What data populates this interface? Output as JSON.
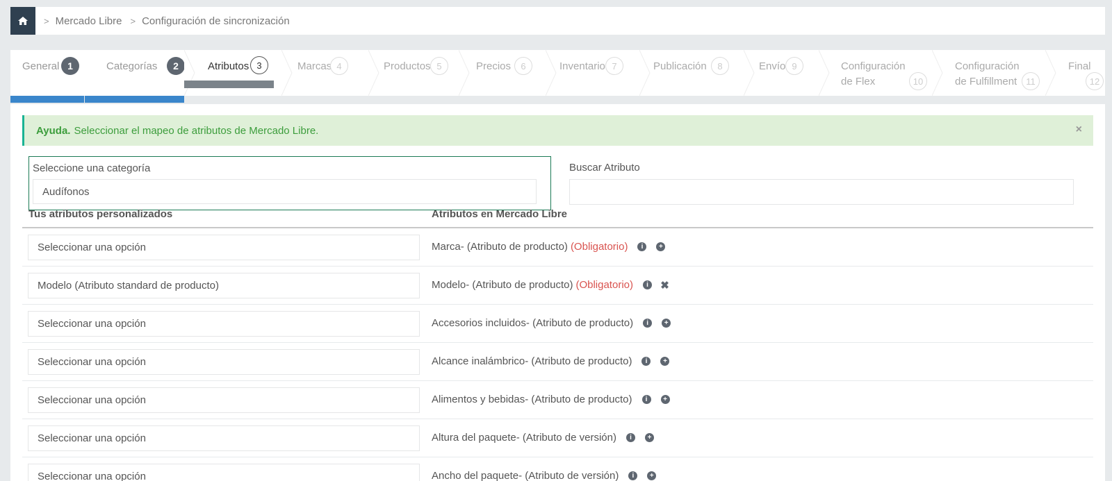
{
  "breadcrumb": {
    "items": [
      "Mercado Libre",
      "Configuración de sincronización"
    ],
    "separator": ">"
  },
  "wizard": {
    "steps": [
      {
        "label": "General",
        "num": "1",
        "state": "done"
      },
      {
        "label": "Categorías",
        "num": "2",
        "state": "done"
      },
      {
        "label": "Atributos",
        "num": "3",
        "state": "active"
      },
      {
        "label": "Marcas",
        "num": "4",
        "state": "todo"
      },
      {
        "label": "Productos",
        "num": "5",
        "state": "todo"
      },
      {
        "label": "Precios",
        "num": "6",
        "state": "todo"
      },
      {
        "label": "Inventario",
        "num": "7",
        "state": "todo"
      },
      {
        "label": "Publicación",
        "num": "8",
        "state": "todo"
      },
      {
        "label": "Envío",
        "num": "9",
        "state": "todo"
      },
      {
        "label": "Configuración de Flex",
        "label1": "Configuración",
        "label2": "de Flex",
        "num": "10",
        "state": "todo"
      },
      {
        "label": "Configuración de Fulfillment",
        "label1": "Configuración",
        "label2": "de Fulfillment",
        "num": "11",
        "state": "todo"
      },
      {
        "label": "Final",
        "num": "12",
        "state": "todo"
      }
    ]
  },
  "alert": {
    "bold": "Ayuda.",
    "text": "Seleccionar el mapeo de atributos de Mercado Libre.",
    "close": "×"
  },
  "category": {
    "label": "Seleccione una categoría",
    "value": "Audífonos"
  },
  "search": {
    "label": "Buscar Atributo",
    "value": "",
    "placeholder": ""
  },
  "columns": {
    "left": "Tus atributos personalizados",
    "right": "Atributos en Mercado Libre"
  },
  "rows": [
    {
      "select": "Seleccionar una opción",
      "name": "Marca",
      "type": " - (Atributo de producto)",
      "required": "(Obligatorio)",
      "action": "add"
    },
    {
      "select": "Modelo (Atributo standard de producto)",
      "name": "Modelo",
      "type": " - (Atributo de producto)",
      "required": "(Obligatorio)",
      "action": "remove"
    },
    {
      "select": "Seleccionar una opción",
      "name": "Accesorios incluidos",
      "type": " - (Atributo de producto)",
      "required": "",
      "action": "add"
    },
    {
      "select": "Seleccionar una opción",
      "name": "Alcance inalámbrico",
      "type": " - (Atributo de producto)",
      "required": "",
      "action": "add"
    },
    {
      "select": "Seleccionar una opción",
      "name": "Alimentos y bebidas",
      "type": " - (Atributo de producto)",
      "required": "",
      "action": "add"
    },
    {
      "select": "Seleccionar una opción",
      "name": "Altura del paquete",
      "type": " - (Atributo de versión)",
      "required": "",
      "action": "add"
    },
    {
      "select": "Seleccionar una opción",
      "name": "Ancho del paquete",
      "type": " - (Atributo de versión)",
      "required": "",
      "action": "add"
    }
  ],
  "colors": {
    "accent": "#3a86cb",
    "step_done": "#5e6670",
    "required": "#d9534f",
    "alert_bg": "#dff0d8",
    "alert_text": "#3c9d3c",
    "home": "#2f4050"
  },
  "icons": {
    "home": "home-icon",
    "info": "info-circle-icon",
    "add": "plus-circle-icon",
    "remove": "times-icon",
    "close": "close-icon"
  }
}
